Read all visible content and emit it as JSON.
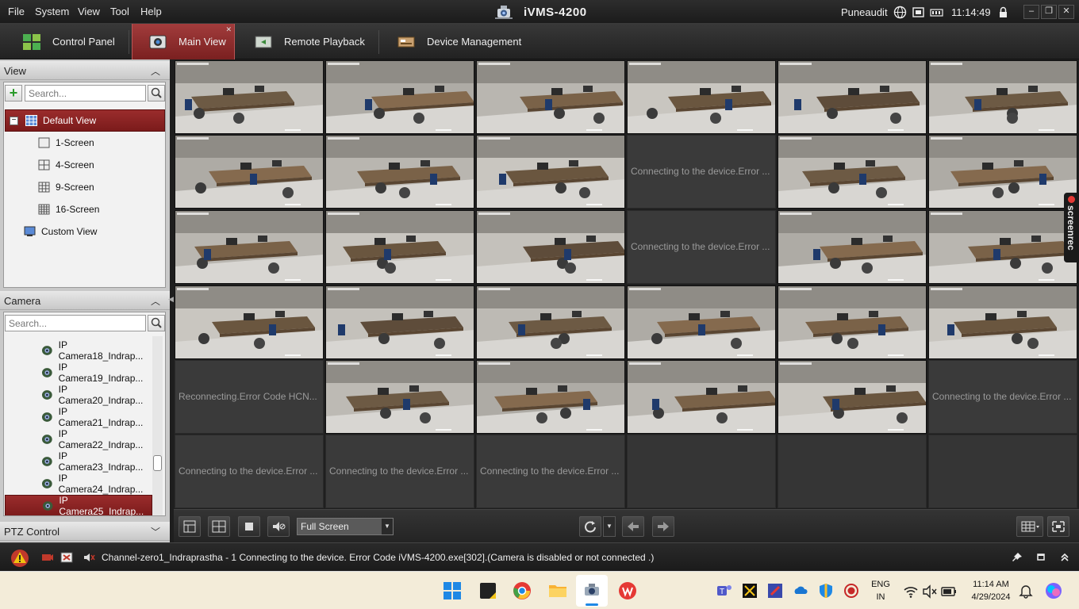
{
  "menu": {
    "items": [
      "File",
      "System",
      "View",
      "Tool",
      "Help"
    ]
  },
  "app": {
    "title": "iVMS-4200"
  },
  "system": {
    "user": "Puneaudit",
    "time": "11:14:49"
  },
  "tabs": [
    {
      "label": "Control Panel",
      "icon": "grid-icon"
    },
    {
      "label": "Main View",
      "icon": "camera-icon",
      "active": true
    },
    {
      "label": "Remote Playback",
      "icon": "playback-icon"
    },
    {
      "label": "Device Management",
      "icon": "device-icon"
    }
  ],
  "view_panel": {
    "title": "View",
    "search_placeholder": "Search...",
    "tree": [
      {
        "label": "Default View",
        "selected": true
      },
      {
        "label": "1-Screen"
      },
      {
        "label": "4-Screen"
      },
      {
        "label": "9-Screen"
      },
      {
        "label": "16-Screen"
      },
      {
        "label": "Custom View"
      }
    ]
  },
  "camera_panel": {
    "title": "Camera",
    "search_placeholder": "Search...",
    "cameras": [
      "IP Camera18_Indrap...",
      "IP Camera19_Indrap...",
      "IP Camera20_Indrap...",
      "IP Camera21_Indrap...",
      "IP Camera22_Indrap...",
      "IP Camera23_Indrap...",
      "IP Camera24_Indrap...",
      "IP Camera25_Indrap..."
    ],
    "selected_index": 7
  },
  "ptz_panel": {
    "title": "PTZ Control"
  },
  "grid": {
    "messages": {
      "connecting": "Connecting to the device.Error ...",
      "reconnecting": "Reconnecting.Error Code HCN..."
    },
    "cells": [
      "feed",
      "feed",
      "feed",
      "feed",
      "feed",
      "feed",
      "feed",
      "feed",
      "feed",
      "connecting",
      "feed",
      "feed",
      "feed",
      "feed",
      "feed",
      "connecting",
      "feed",
      "feed",
      "feed",
      "feed",
      "feed",
      "feed",
      "feed",
      "feed",
      "reconnecting",
      "feed",
      "feed",
      "feed",
      "feed",
      "connecting",
      "connecting",
      "connecting",
      "connecting",
      "empty",
      "empty",
      "empty"
    ]
  },
  "toolbar": {
    "screen_mode": "Full Screen"
  },
  "status": {
    "message": "Channel-zero1_Indraprastha - 1 Connecting to the device. Error Code iVMS-4200.exe[302].(Camera is disabled or not connected .)"
  },
  "screenrec": {
    "label": "screenrec"
  },
  "taskbar": {
    "lang_top": "ENG",
    "lang_bottom": "IN",
    "time": "11:14 AM",
    "date": "4/29/2024"
  }
}
